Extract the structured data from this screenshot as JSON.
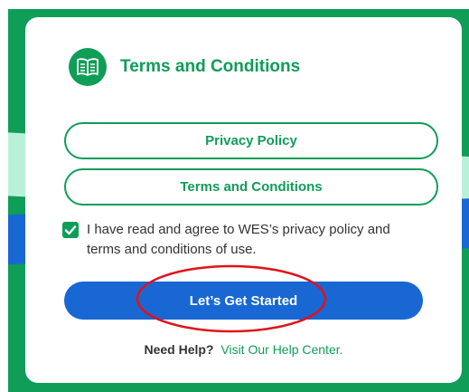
{
  "dialog": {
    "title": "Terms and Conditions",
    "icon": "book-icon",
    "buttons": {
      "privacy_policy": "Privacy Policy",
      "terms_and_conditions": "Terms and Conditions"
    },
    "agreement": {
      "checked": true,
      "text": "I have read and agree to WES’s privacy policy and terms and conditions of use."
    },
    "primary_button": "Let’s Get Started",
    "help": {
      "question": "Need Help?",
      "link": "Visit Our Help Center."
    }
  },
  "colors": {
    "brand_green": "#0f9d58",
    "brand_blue": "#1967d2",
    "mint": "#b9f0d9",
    "annotation_red": "#e0121b"
  }
}
